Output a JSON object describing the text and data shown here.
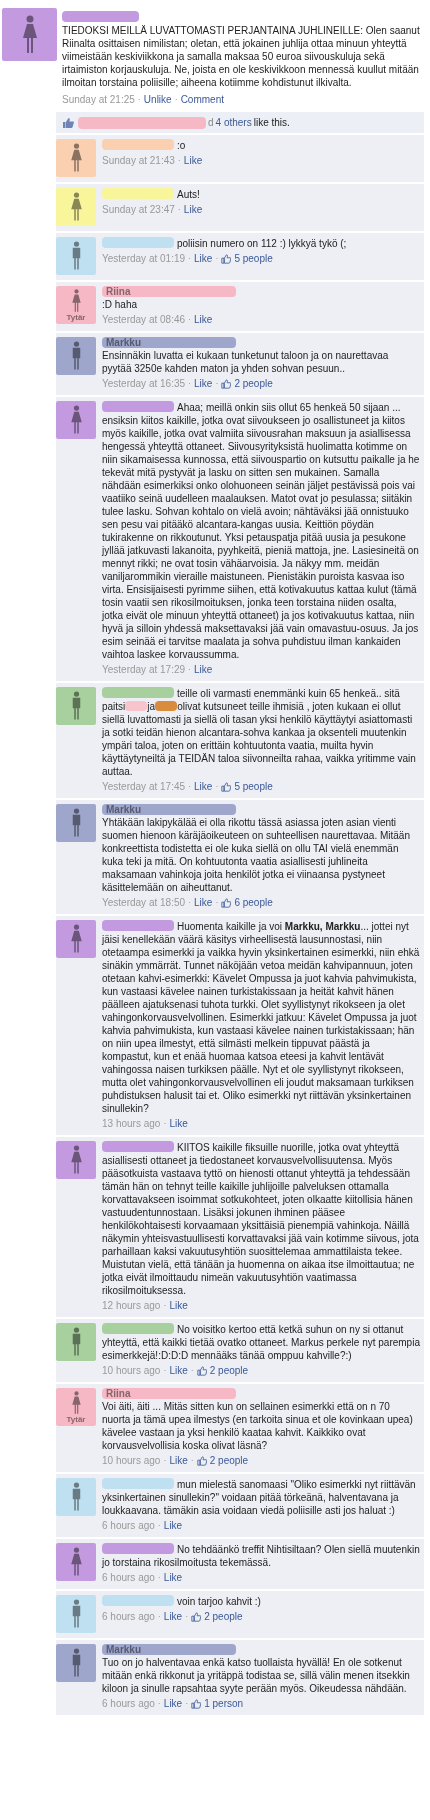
{
  "sep": "·",
  "post": {
    "color": "#c39ae0",
    "kind": "female",
    "text": "TIEDOKSI MEILLÄ LUVATTOMASTI PERJANTAINA JUHLINEILLE: Olen saanut Riinalta osittaisen nimilistan; oletan, että jokainen juhlija ottaa minuun yhteyttä viimeistään keskiviikkona ja samalla maksaa 50 euroa siivouskuluja sekä irtaimiston korjauskuluja. Ne, joista en ole keskivikkoon mennessä kuullut mitään ilmoitan torstaina poliisille; aiheena kotiimme kohdistunut ilkivalta.",
    "time": "Sunday at 21:25",
    "actions": [
      "Unlike",
      "Comment"
    ]
  },
  "likes_bar": {
    "color": "#f6b8c4",
    "prefix": "d",
    "link": "4 others",
    "suffix": "like this."
  },
  "comments": [
    {
      "kind": "female",
      "color": "#fbd0b0",
      "text": ":o",
      "time": "Sunday at 21:43",
      "like": "Like"
    },
    {
      "kind": "female",
      "color": "#f8f59a",
      "text": "Auts!",
      "time": "Sunday at 23:47",
      "like": "Like"
    },
    {
      "kind": "male",
      "color": "#bfe0f0",
      "text": "poliisin numero on 112 :) lykkyä tykö (;",
      "time": "Yesterday at 01:19",
      "like": "Like",
      "likes": "5 people"
    },
    {
      "kind": "female",
      "color": "#f6b8c4",
      "badge": "Tytär",
      "name": "Riina",
      "text": ":D haha",
      "time": "Yesterday at 08:46",
      "like": "Like"
    },
    {
      "kind": "male",
      "color": "#9ea6cc",
      "name": "Markku",
      "text": "Ensinnäkin luvatta ei kukaan tunketunut taloon ja on naurettavaa pyytää 3250e kahden maton ja yhden sohvan pesuun..",
      "time": "Yesterday at 16:35",
      "like": "Like",
      "likes": "2 people"
    },
    {
      "kind": "female",
      "color": "#c39ae0",
      "text": "Ahaa; meillä onkin siis ollut 65 henkeä 50 sijaan ... ensiksin kiitos kaikille, jotka ovat siivoukseen jo osallistuneet ja kiitos myös kaikille, jotka ovat valmiita siivousrahan maksuun ja asiallisessa hengessä yhteyttä ottaneet. Siivousyrityksistä huolimatta kotimme on niin sikamaisessa kunnossa, että siivouspartio on kutsuttu paikalle ja he tekevät mitä pystyvät ja lasku on sitten sen mukainen. Samalla nähdään esimerkiksi onko olohuoneen seinän jäljet pestävissä pois vai vaatiiko seinä uudelleen maalauksen. Matot ovat jo pesulassa; siitäkin tulee lasku. Sohvan kohtalo on vielä avoin; nähtäväksi jää onnistuuko sen pesu vai pitääkö alcantara-kangas uusia. Keittiön pöydän tukirakenne on rikkoutunut. Yksi petauspatja pitää uusia ja pesukone jyllää jatkuvasti lakanoita, pyyhkeitä, pieniä mattoja, jne. Lasiesineitä on mennyt rikki; ne ovat tosin vähäarvoisia. Ja näkyy mm. meidän vaniljarommikin vieraille maistuneen. Pienistäkin puroista kasvaa iso virta. Ensisijaisesti pyrimme siihen, että kotivakuutus kattaa kulut (tämä tosin vaatii sen rikosilmoituksen, jonka teen torstaina niiden osalta, jotka eivät ole minuun yhteyttä ottaneet) ja jos kotivakuutus kattaa, niin hyvä ja silloin yhdessä maksettavaksi jää vain omavastuu-osuus. Ja jos esim seinää ei tarvitse maalata ja sohva puhdistuu ilman kankaiden vaihtoa laskee korvaussumma.",
      "time": "Yesterday at 17:29",
      "like": "Like"
    },
    {
      "kind": "male",
      "color": "#a8cf9e",
      "parts": [
        {
          "kind": "text",
          "text": "teille oli varmasti enemmänki kuin 65 henkeä.. sitä paitsi"
        },
        {
          "kind": "redaction",
          "color": "#f8c4cc"
        },
        {
          "kind": "text",
          "text": "ja"
        },
        {
          "kind": "redaction",
          "color": "#d98c3c"
        },
        {
          "kind": "text",
          "text": "olivat kutsuneet teille ihmisiä , joten kukaan ei ollut siellä luvattomasti ja siellä oli tasan yksi henkilö käyttäytyi asiattomasti ja sotki teidän hienon alcantara-sohva kankaa ja oksenteli muutenkin ympäri taloa, joten on erittäin kohtuutonta vaatia, muilta hyvin käyttäytyneiltä ja TEIDÄN taloa siivonneilta rahaa, vaikka yritimme vain auttaa."
        }
      ],
      "time": "Yesterday at 17:45",
      "like": "Like",
      "likes": "5 people"
    },
    {
      "kind": "male",
      "color": "#9ea6cc",
      "name": "Markku",
      "text": "Yhtäkään lakipykälää ei olla rikottu tässä asiassa joten asian vienti suomen hienoon käräjäoikeuteen on suhteellisen naurettavaa. Mitään konkreettista todistetta ei ole kuka siellä on ollu TAI vielä enemmän kuka teki ja mitä. On kohtuutonta vaatia asiallisesti juhlineita maksamaan vahinkoja joita henkilöt jotka ei viinaansa pystyneet käsittelemään on aiheuttanut.",
      "time": "Yesterday at 18:50",
      "like": "Like",
      "likes": "6 people"
    },
    {
      "kind": "female",
      "color": "#c39ae0",
      "text": "Huomenta kaikille ja voi **Markku, Markku**... jottei nyt jäisi kenellekään väärä käsitys virheellisestä lausunnostasi, niin otetaampa esimerkki ja vaikka hyvin yksinkertainen esimerkki, niin ehkä sinäkin ymmärrät. Tunnet näköjään vetoa meidän kahvipannuun, joten otetaan kahvi-esimerkki: Kävelet Ompussa ja juot kahvia pahvimukista, kun vastaasi kävelee nainen turkistakissaan ja heität kahvit hänen päälleen ajatuksenasi tuhota turkki. Olet syyllistynyt rikokseen ja olet vahingonkorvausvelvollinen. Esimerkki jatkuu: Kävelet Ompussa ja juot kahvia pahvimukista, kun vastaasi kävelee nainen turkistakissaan; hän on niin upea ilmestyt, että silmästi melkein tippuvat päästä ja kompastut, kun et enää huomaa katsoa eteesi ja kahvit lentävät vahingossa naisen turkiksen päälle. Nyt et ole syyllistynyt rikokseen, mutta olet vahingonkorvausvelvollinen eli joudut maksamaan turkiksen puhdistuksen halusit tai et. Oliko esimerkki nyt riittävän yksinkertainen sinullekin?",
      "time": "13 hours ago",
      "like": "Like"
    },
    {
      "kind": "female",
      "color": "#c39ae0",
      "text": "KIITOS kaikille fiksuille nuorille, jotka ovat yhteyttä asiallisesti ottaneet ja tiedostaneet korvausvelvollisuutensa. Myös pääsotkuista vastaava tyttö on hienosti ottanut yhteyttä ja tehdessään tämän hän on tehnyt teille kaikille juhlijoille palveluksen ottamalla korvattavakseen isoimmat sotkukohteet, joten olkaatte kiitollisia hänen vastuudentunnostaan. Lisäksi jokunen ihminen pääsee henkilökohtaisesti korvaamaan yksittäisiä pienempiä vahinkoja. Näillä näkymin yhteisvastuullisesti korvattavaksi jää vain kotimme siivous, jota parhaillaan kaksi vakuutusyhtiön suosittelemaa ammattilaista tekee. Muistutan vielä, että tänään ja huomenna on aikaa itse ilmoittautua; ne jotka eivät ilmoittaudu nimeän vakuutusyhtiön vaatimassa rikosilmoituksessa.",
      "time": "12 hours ago",
      "like": "Like"
    },
    {
      "kind": "male",
      "color": "#a8cf9e",
      "text": "No voisitko kertoo että ketkä suhun on ny si ottanut yhteyttä, että kaikki tietää ovatko ottaneet. Markus perkele nyt parempia esimerkkejä!:D:D:D mennääks tänää omppuu kahville?:)",
      "time": "10 hours ago",
      "like": "Like",
      "likes": "2 people"
    },
    {
      "kind": "female",
      "color": "#f6b8c4",
      "badge": "Tytär",
      "name": "Riina",
      "text": "Voi äiti, äiti ... Mitäs sitten kun on sellainen esimerkki että on n 70 nuorta ja tämä upea ilmestys (en tarkoita sinua et ole kovinkaan upea) kävelee vastaan ja yksi henkilö kaataa kahvit. Kaikkiko ovat korvausvelvollisia koska olivat läsnä?",
      "time": "10 hours ago",
      "like": "Like",
      "likes": "2 people"
    },
    {
      "kind": "male",
      "color": "#bfe0f0",
      "text": "mun mielestä sanomaasi \"Oliko esimerkki nyt riittävän yksinkertainen sinullekin?\" voidaan pitää törkeänä, halventavana ja loukkaavana. tämäkin asia voidaan viedä poliisille asti jos haluat :)",
      "time": "6 hours ago",
      "like": "Like"
    },
    {
      "kind": "female",
      "color": "#c39ae0",
      "text": "No tehdäänkö treffit Nihtisiltaan? Olen siellä muutenkin jo torstaina rikosilmoitusta tekemässä.",
      "time": "6 hours ago",
      "like": "Like"
    },
    {
      "kind": "male",
      "color": "#bfe0f0",
      "text": "voin tarjoo kahvit :)",
      "time": "6 hours ago",
      "like": "Like",
      "likes": "2 people"
    },
    {
      "kind": "male",
      "color": "#9ea6cc",
      "name": "Markku",
      "text": "Tuo on jo halventavaa enkä katso tuollaista hyvällä! En ole sotkenut mitään enkä rikkonut ja yritäppä todistaa se, sillä välin menen itsekkin kiloon ja sinulle rapsahtaa syyte perään myös. Oikeudessa nähdään.",
      "time": "6 hours ago",
      "like": "Like",
      "likes": "1 person"
    }
  ]
}
